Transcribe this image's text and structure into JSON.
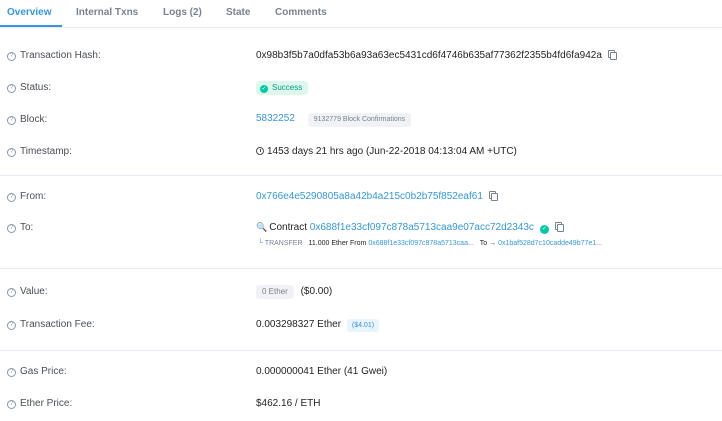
{
  "tabs": [
    {
      "label": "Overview",
      "active": true
    },
    {
      "label": "Internal Txns",
      "active": false
    },
    {
      "label": "Logs (2)",
      "active": false
    },
    {
      "label": "State",
      "active": false
    },
    {
      "label": "Comments",
      "active": false
    }
  ],
  "fields": {
    "tx_hash": {
      "label": "Transaction Hash:",
      "value": "0x98b3f5b7a0dfa53b6a93a63ec5431cd6f4746b635af77362f2355b4fd6fa942a"
    },
    "status": {
      "label": "Status:",
      "value": "Success"
    },
    "block": {
      "label": "Block:",
      "value": "5832252",
      "confirmations": "9132779 Block Confirmations"
    },
    "timestamp": {
      "label": "Timestamp:",
      "value": "1453 days 21 hrs ago (Jun-22-2018 04:13:04 AM +UTC)"
    },
    "from": {
      "label": "From:",
      "value": "0x766e4e5290805a8a42b4a215c0b2b75f852eaf61"
    },
    "to": {
      "label": "To:",
      "prefix": "Contract",
      "value": "0x688f1e33cf097c878a5713caa9e07acc72d2343c",
      "transfer": {
        "type": "TRANSFER",
        "amount": "11.000 Ether",
        "from_label": "From",
        "from_addr": "0x688f1e33cf097c878a5713caa...",
        "to_label": "To",
        "to_addr": "0x1baf528d7c10cadde49b77e1..."
      }
    },
    "value": {
      "label": "Value:",
      "badge": "0 Ether",
      "usd": "($0.00)"
    },
    "fee": {
      "label": "Transaction Fee:",
      "value": "0.003298327 Ether",
      "usd": "($4.01)"
    },
    "gas_price": {
      "label": "Gas Price:",
      "value": "0.000000041 Ether (41 Gwei)"
    },
    "ether_price": {
      "label": "Ether Price:",
      "value": "$462.16 / ETH"
    }
  },
  "icons": {
    "help": "question-circle-icon",
    "copy": "copy-icon",
    "clock": "clock-icon",
    "check": "check-circle-icon",
    "contract": "search-contract-icon",
    "transfer_arrow": "corner-down-right-icon"
  },
  "colors": {
    "accent": "#3498db",
    "success_bg": "#def7ec",
    "success_text": "#00a186",
    "divider": "#e7eaf3"
  }
}
